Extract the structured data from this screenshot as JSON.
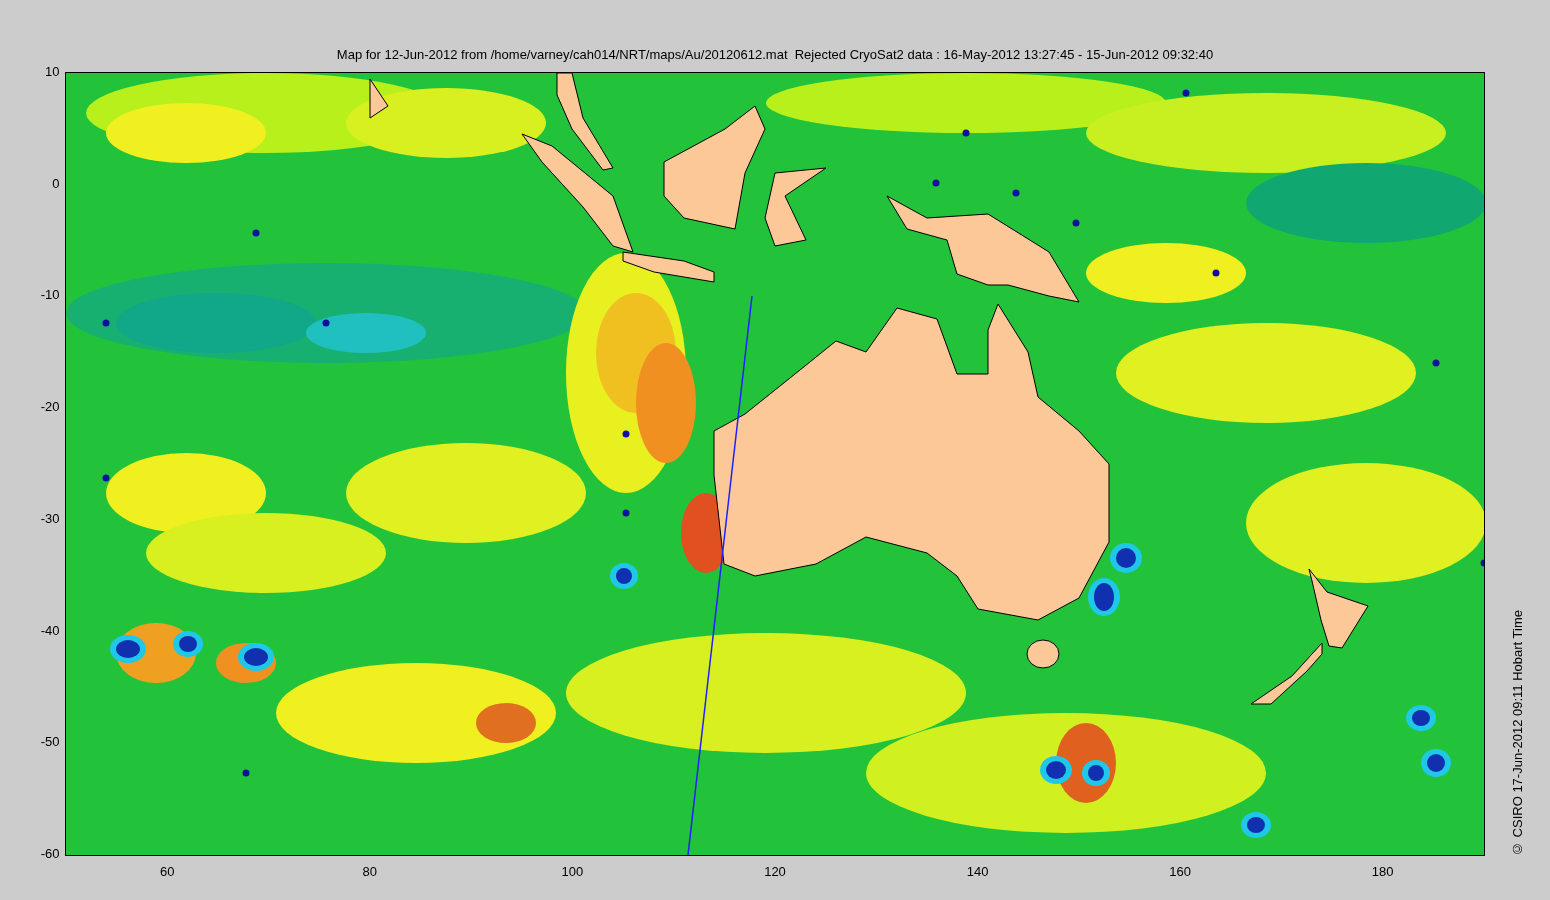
{
  "figure": {
    "title": "Map for 12-Jun-2012 from /home/varney/cah014/NRT/maps/Au/20120612.mat  Rejected CryoSat2 data : 16-May-2012 13:27:45 - 15-Jun-2012 09:32:40",
    "y_ticks": [
      "10",
      "0",
      "-10",
      "-20",
      "-30",
      "-40",
      "-50",
      "-60"
    ],
    "x_ticks": [
      "60",
      "80",
      "100",
      "120",
      "140",
      "160",
      "180"
    ],
    "credit": "© CSIRO 17-Jun-2012 09:11 Hobart Time"
  }
}
